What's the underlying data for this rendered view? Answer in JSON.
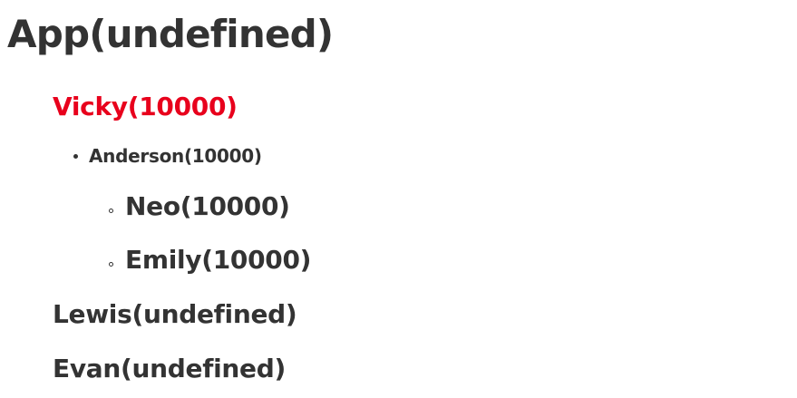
{
  "app": {
    "title": "App(undefined)"
  },
  "tree": {
    "vicky": {
      "label": "Vicky(10000)",
      "color": "#e8001c"
    },
    "anderson": {
      "label": "Anderson(10000)"
    },
    "neo": {
      "label": "Neo(10000)"
    },
    "emily": {
      "label": "Emily(10000)"
    },
    "lewis": {
      "label": "Lewis(undefined)"
    },
    "evan": {
      "label": "Evan(undefined)"
    }
  },
  "icons": {
    "anderson_bullet": "disc-bullet-icon",
    "neo_bullet": "circle-bullet-icon",
    "emily_bullet": "circle-bullet-icon"
  }
}
